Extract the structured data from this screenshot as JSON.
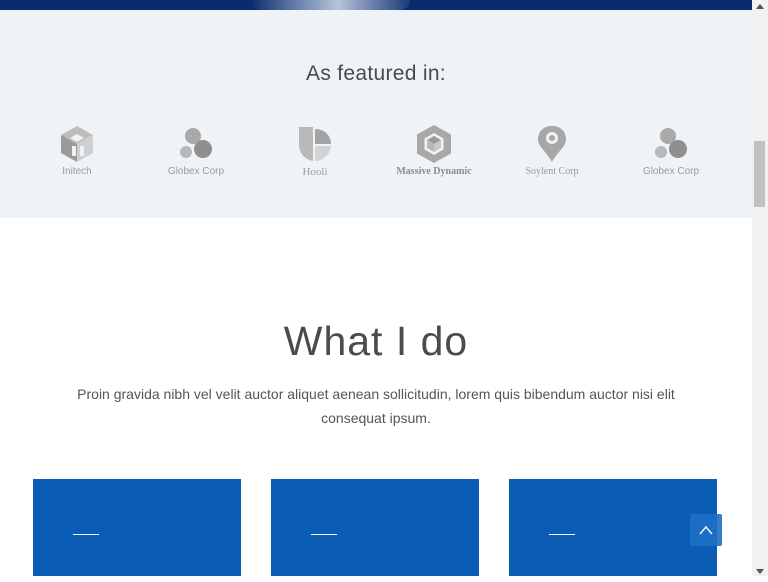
{
  "featured": {
    "title": "As featured in:",
    "logos": [
      {
        "name": "Initech",
        "icon": "initech-cube-icon"
      },
      {
        "name": "Globex Corp",
        "icon": "globex-circles-icon"
      },
      {
        "name": "Hooli",
        "icon": "hooli-leaf-icon"
      },
      {
        "name": "Massive Dynamic",
        "icon": "massive-dynamic-hexagon-icon"
      },
      {
        "name": "Soylent Corp",
        "icon": "soylent-pin-icon"
      },
      {
        "name": "Globex Corp",
        "icon": "globex-circles-icon"
      }
    ]
  },
  "what_i_do": {
    "title": "What I do",
    "description": "Proin gravida nibh vel velit auctor aliquet aenean sollicitudin, lorem quis bibendum auctor nisi elit consequat ipsum."
  },
  "colors": {
    "featured_bg": "#eef3f7",
    "card_blue": "#0a5cb4",
    "hero_dark_blue": "#0b2a6e",
    "scroll_top_button": "#1f6fc6"
  },
  "scroll_top": {
    "icon": "chevron-up-icon"
  }
}
